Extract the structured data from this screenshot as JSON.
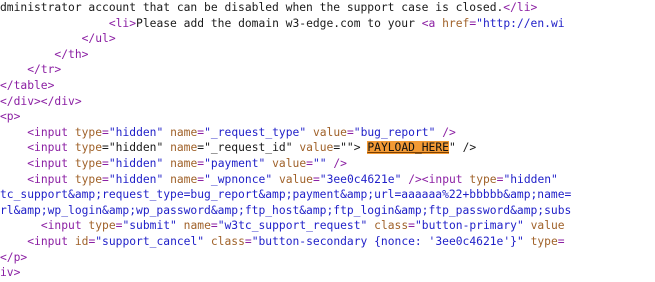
{
  "source_view": {
    "lines": [
      {
        "indent": 0,
        "tokens": [
          {
            "t": "txt",
            "v": "dministrator account that can be disabled when the support case is closed."
          },
          {
            "t": "tag",
            "v": "</li>"
          }
        ]
      },
      {
        "indent": 16,
        "tokens": [
          {
            "t": "tag",
            "v": "<li>"
          },
          {
            "t": "txt",
            "v": "Please add the domain w3-edge.com to your "
          },
          {
            "t": "tag",
            "v": "<a "
          },
          {
            "t": "attr",
            "v": "href"
          },
          {
            "t": "tag",
            "v": "="
          },
          {
            "t": "str",
            "v": "\"http://en.wi"
          }
        ]
      },
      {
        "indent": 12,
        "tokens": [
          {
            "t": "tag",
            "v": "</ul>"
          }
        ]
      },
      {
        "indent": 8,
        "tokens": [
          {
            "t": "tag",
            "v": "</th>"
          }
        ]
      },
      {
        "indent": 4,
        "tokens": [
          {
            "t": "tag",
            "v": "</tr>"
          }
        ]
      },
      {
        "indent": 0,
        "tokens": [
          {
            "t": "tag",
            "v": "</table>"
          }
        ]
      },
      {
        "indent": 0,
        "tokens": [
          {
            "t": "tag",
            "v": "</div></div>"
          }
        ]
      },
      {
        "indent": 0,
        "tokens": [
          {
            "t": "tag",
            "v": "<p>"
          }
        ]
      },
      {
        "indent": 4,
        "tokens": [
          {
            "t": "tag",
            "v": "<input "
          },
          {
            "t": "attr",
            "v": "type"
          },
          {
            "t": "tag",
            "v": "="
          },
          {
            "t": "str",
            "v": "\"hidden\" "
          },
          {
            "t": "attr",
            "v": "name"
          },
          {
            "t": "tag",
            "v": "="
          },
          {
            "t": "str",
            "v": "\"_request_type\" "
          },
          {
            "t": "attr",
            "v": "value"
          },
          {
            "t": "tag",
            "v": "="
          },
          {
            "t": "str",
            "v": "\"bug_report\" "
          },
          {
            "t": "tag",
            "v": "/>"
          }
        ]
      },
      {
        "indent": 4,
        "tokens": [
          {
            "t": "tag",
            "v": "<input "
          },
          {
            "t": "attr",
            "v": "type"
          },
          {
            "t": "txt",
            "v": "=\"hidden\" "
          },
          {
            "t": "attr",
            "v": "name"
          },
          {
            "t": "txt",
            "v": "=\"_request_id\" "
          },
          {
            "t": "attr",
            "v": "value"
          },
          {
            "t": "txt",
            "v": "=\"\"> "
          },
          {
            "t": "hl",
            "v": "PAYLOAD_HERE"
          },
          {
            "t": "txt",
            "v": "\" />"
          }
        ]
      },
      {
        "indent": 4,
        "tokens": [
          {
            "t": "tag",
            "v": "<input "
          },
          {
            "t": "attr",
            "v": "type"
          },
          {
            "t": "tag",
            "v": "="
          },
          {
            "t": "str",
            "v": "\"hidden\" "
          },
          {
            "t": "attr",
            "v": "name"
          },
          {
            "t": "tag",
            "v": "="
          },
          {
            "t": "str",
            "v": "\"payment\" "
          },
          {
            "t": "attr",
            "v": "value"
          },
          {
            "t": "tag",
            "v": "="
          },
          {
            "t": "str",
            "v": "\"\" "
          },
          {
            "t": "tag",
            "v": "/>"
          }
        ]
      },
      {
        "indent": 4,
        "tokens": [
          {
            "t": "tag",
            "v": "<input "
          },
          {
            "t": "attr",
            "v": "type"
          },
          {
            "t": "tag",
            "v": "="
          },
          {
            "t": "str",
            "v": "\"hidden\" "
          },
          {
            "t": "attr",
            "v": "name"
          },
          {
            "t": "tag",
            "v": "="
          },
          {
            "t": "str",
            "v": "\"_wpnonce\" "
          },
          {
            "t": "attr",
            "v": "value"
          },
          {
            "t": "tag",
            "v": "="
          },
          {
            "t": "str",
            "v": "\"3ee0c4621e\" "
          },
          {
            "t": "tag",
            "v": "/><input "
          },
          {
            "t": "attr",
            "v": "type"
          },
          {
            "t": "tag",
            "v": "="
          },
          {
            "t": "str",
            "v": "\"hidden\""
          }
        ]
      },
      {
        "indent": 0,
        "tokens": [
          {
            "t": "str",
            "v": "tc_support&amp;request_type=bug_report&amp;payment&amp;url=aaaaaa%22+bbbbb&amp;name="
          }
        ]
      },
      {
        "indent": 0,
        "tokens": [
          {
            "t": "str",
            "v": "rl&amp;wp_login&amp;wp_password&amp;ftp_host&amp;ftp_login&amp;ftp_password&amp;subs"
          }
        ]
      },
      {
        "indent": 6,
        "tokens": [
          {
            "t": "tag",
            "v": "<input "
          },
          {
            "t": "attr",
            "v": "type"
          },
          {
            "t": "tag",
            "v": "="
          },
          {
            "t": "str",
            "v": "\"submit\" "
          },
          {
            "t": "attr",
            "v": "name"
          },
          {
            "t": "tag",
            "v": "="
          },
          {
            "t": "str",
            "v": "\"w3tc_support_request\" "
          },
          {
            "t": "attr",
            "v": "class"
          },
          {
            "t": "tag",
            "v": "="
          },
          {
            "t": "str",
            "v": "\"button-primary\" "
          },
          {
            "t": "attr",
            "v": "value"
          }
        ]
      },
      {
        "indent": 4,
        "tokens": [
          {
            "t": "tag",
            "v": "<input "
          },
          {
            "t": "attr",
            "v": "id"
          },
          {
            "t": "tag",
            "v": "="
          },
          {
            "t": "str",
            "v": "\"support_cancel\" "
          },
          {
            "t": "attr",
            "v": "class"
          },
          {
            "t": "tag",
            "v": "="
          },
          {
            "t": "str",
            "v": "\"button-secondary {nonce: '3ee0c4621e'}\" "
          },
          {
            "t": "attr",
            "v": "type"
          },
          {
            "t": "tag",
            "v": "="
          }
        ]
      },
      {
        "indent": 0,
        "tokens": [
          {
            "t": "tag",
            "v": "</p>"
          }
        ]
      },
      {
        "indent": 0,
        "tokens": [
          {
            "t": "tag",
            "v": "iv>"
          }
        ]
      }
    ]
  }
}
